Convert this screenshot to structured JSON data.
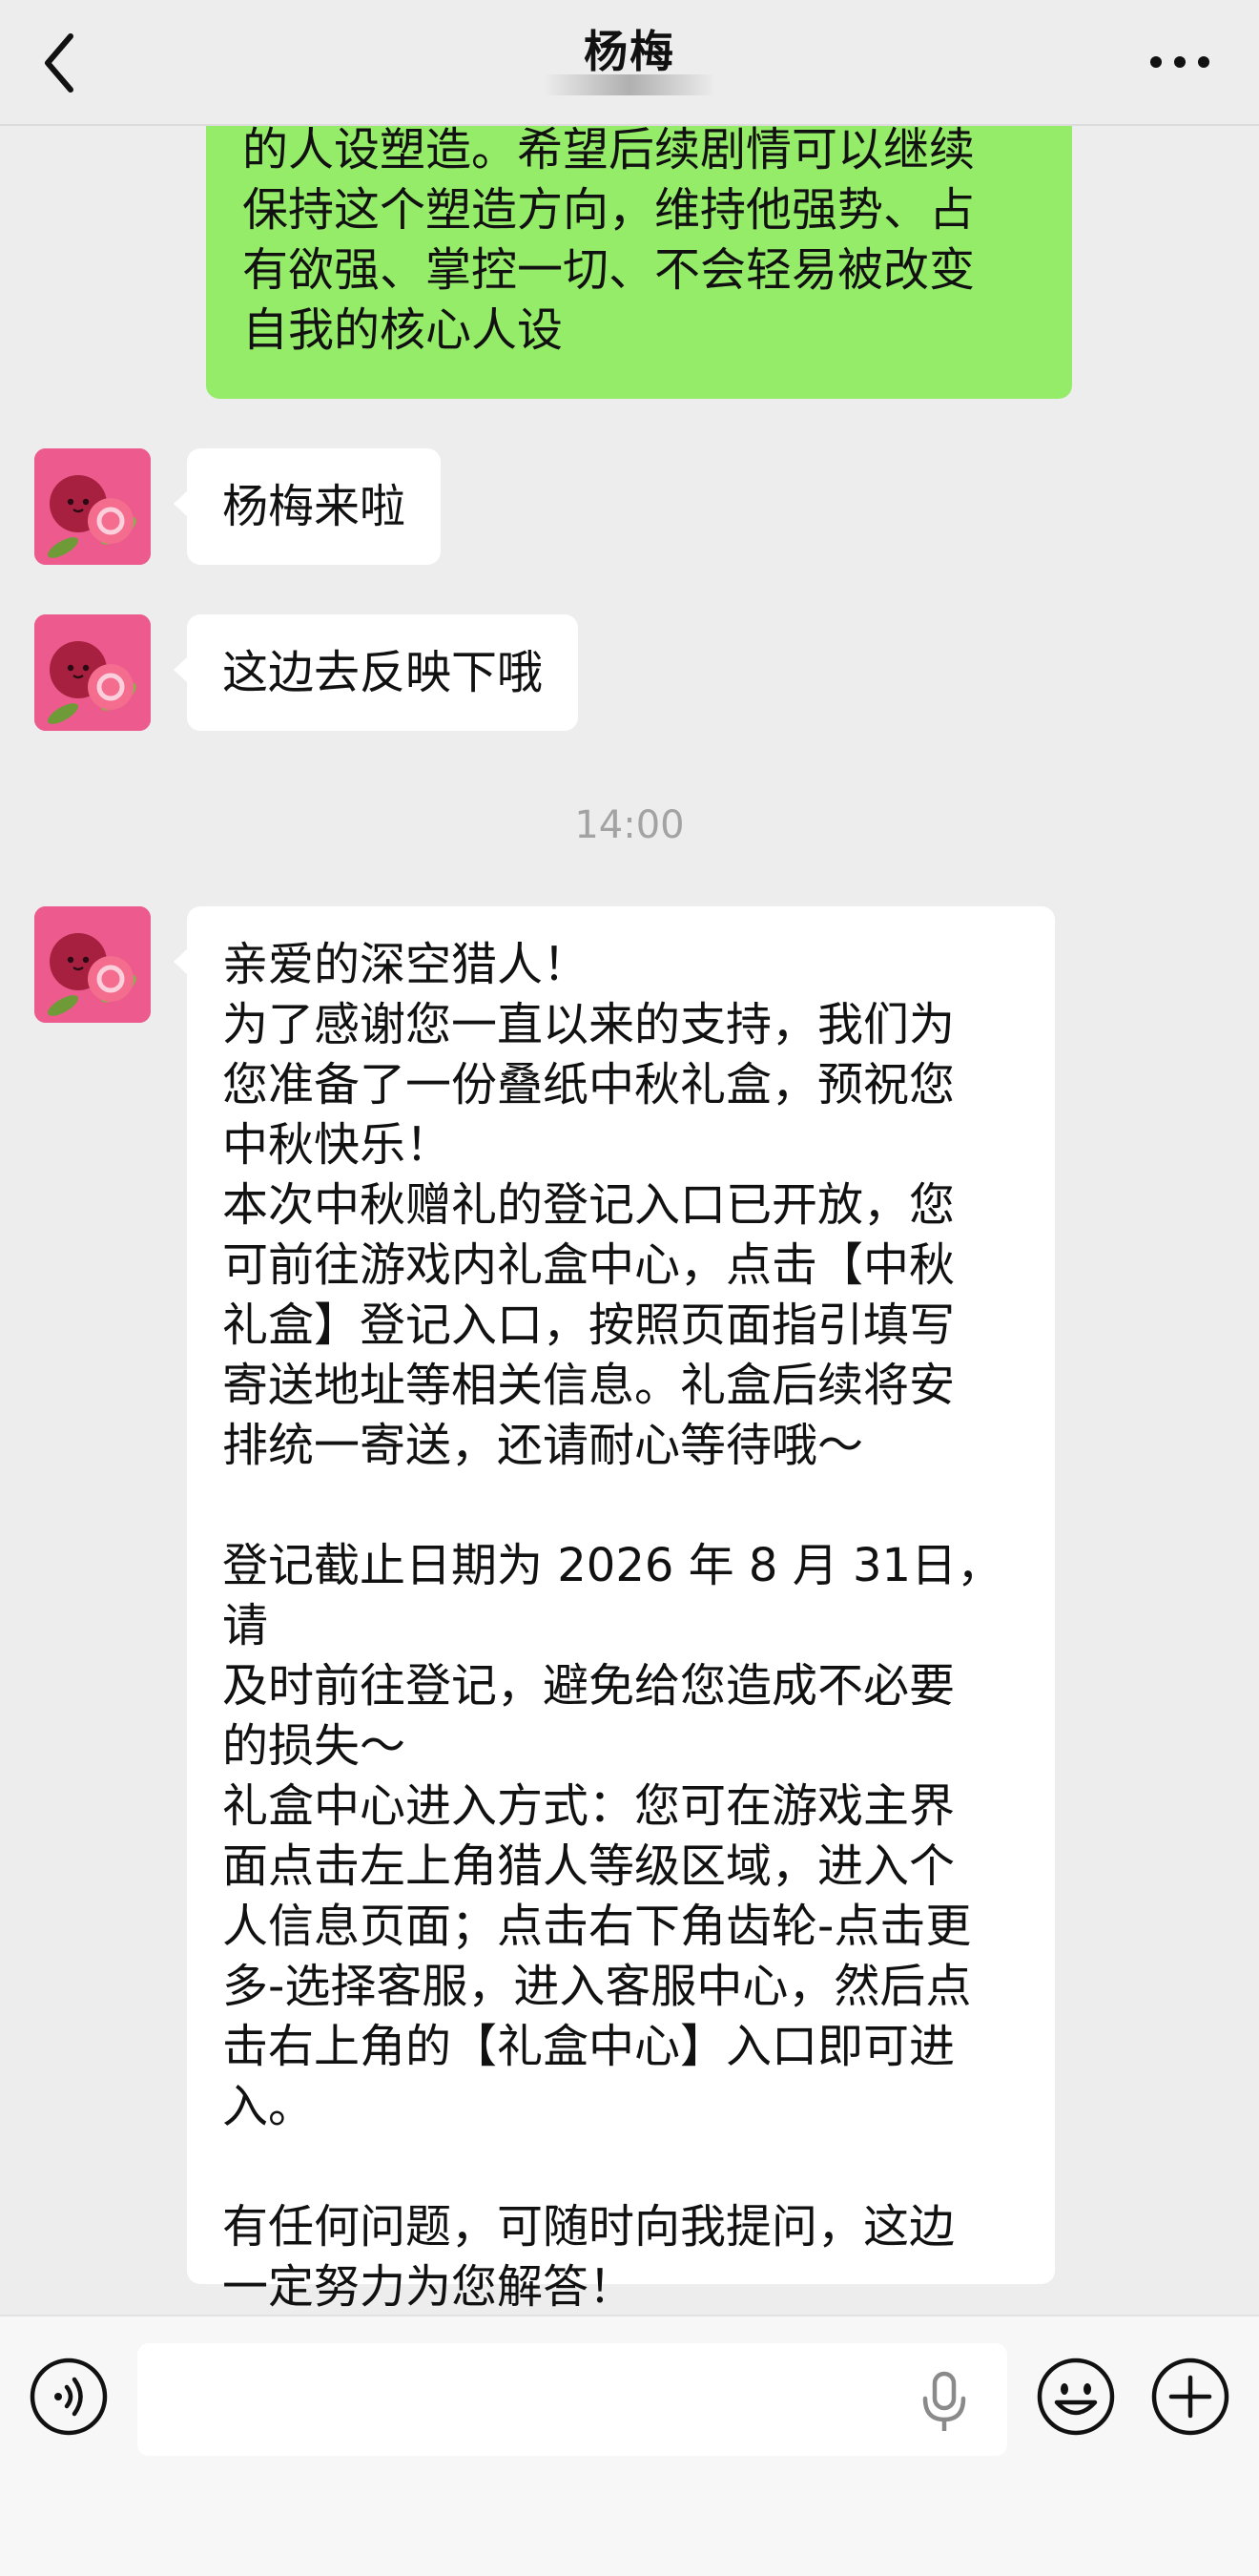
{
  "header": {
    "title": "杨梅",
    "back_icon": "chevron-left-icon",
    "more_icon": "more-dots-icon"
  },
  "messages": {
    "self_partial": "的人设塑造。希望后续剧情可以继续\n保持这个塑造方向，维持他强势、占\n有欲强、掌控一切、不会轻易被改变\n自我的核心人设",
    "in_1": "杨梅来啦",
    "in_2": "这边去反映下哦",
    "time": "14:00",
    "in_3": "亲爱的深空猎人！\n为了感谢您一直以来的支持，我们为\n您准备了一份叠纸中秋礼盒，预祝您\n中秋快乐！\n本次中秋赠礼的登记入口已开放，您\n可前往游戏内礼盒中心，点击【中秋\n礼盒】登记入口，按照页面指引填写\n寄送地址等相关信息。礼盒后续将安\n排统一寄送，还请耐心等待哦～\n\n登记截止日期为 2026 年 8 月 31日，请\n及时前往登记，避免给您造成不必要\n的损失～\n礼盒中心进入方式：您可在游戏主界\n面点击左上角猎人等级区域，进入个\n人信息页面；点击右下角齿轮-点击更\n多-选择客服，进入客服中心，然后点\n击右上角的【礼盒中心】入口即可进\n入。\n\n有任何问题，可随时向我提问，这边\n一定努力为您解答！"
  },
  "colors": {
    "self_bubble": "#95ec69",
    "in_bubble": "#ffffff",
    "background": "#ededed",
    "avatar_bg": "#ec5a8e"
  },
  "input_bar": {
    "value": "",
    "voice_icon": "voice-mode-icon",
    "mic_icon": "microphone-icon",
    "emoji_icon": "emoji-icon",
    "plus_icon": "plus-icon"
  }
}
